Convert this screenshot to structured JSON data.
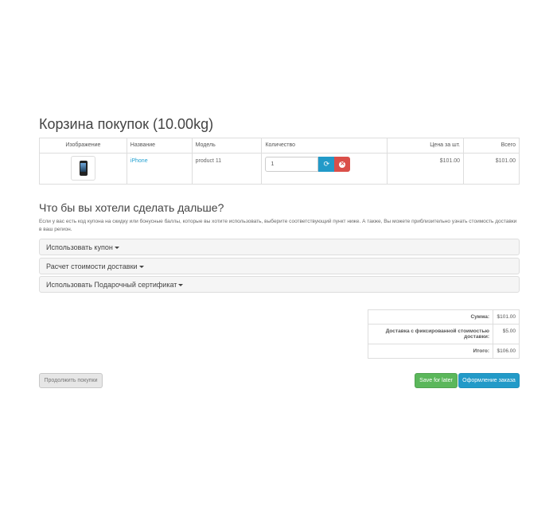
{
  "page": {
    "title": "Корзина покупок  (10.00kg)"
  },
  "cart_table": {
    "headers": {
      "image": "Изображение",
      "name": "Название",
      "model": "Модель",
      "quantity": "Количество",
      "unit_price": "Цена за шт.",
      "total": "Всего"
    },
    "rows": [
      {
        "image_icon": "phone-thumbnail",
        "name": "iPhone",
        "model": "product 11",
        "quantity": "1",
        "unit_price": "$101.00",
        "total": "$101.00"
      }
    ],
    "update_icon": "refresh-icon",
    "remove_icon": "remove-icon"
  },
  "next_section": {
    "title": "Что бы вы хотели сделать дальше?",
    "description": "Если у вас есть код купона на скидку или бонусные баллы, которые вы хотите использовать, выберите соответствующий пункт ниже. А также, Вы можете приблизительно узнать стоимость доставки в ваш регион.",
    "panels": [
      {
        "label": "Использовать купон"
      },
      {
        "label": "Расчет стоимости доставки"
      },
      {
        "label": "Использовать Подарочный сертификат"
      }
    ]
  },
  "totals": [
    {
      "label": "Сумма:",
      "value": "$101.00"
    },
    {
      "label": "Доставка с фиксированной стоимостью доставки:",
      "value": "$5.00"
    },
    {
      "label": "Итого:",
      "value": "$106.00"
    }
  ],
  "buttons": {
    "continue": "Продолжить покупки",
    "save_later": "Save for later",
    "checkout": "Оформление заказа"
  },
  "colors": {
    "link": "#23a1d1",
    "primary": "#229ac8",
    "success": "#5bb75b",
    "danger": "#da4f49"
  }
}
